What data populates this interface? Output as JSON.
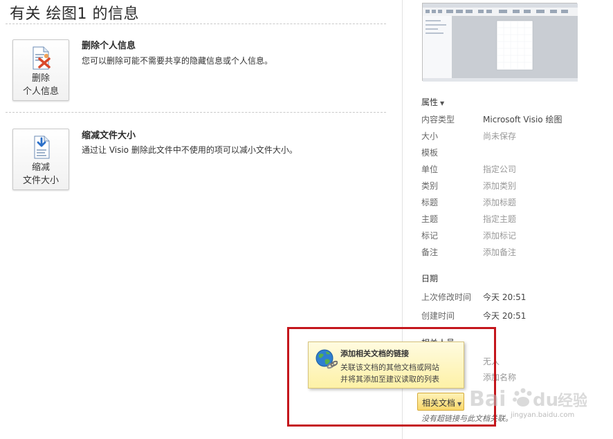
{
  "page": {
    "title": "有关 绘图1 的信息"
  },
  "sections": [
    {
      "button_line1": "删除",
      "button_line2": "个人信息",
      "heading": "删除个人信息",
      "description": "您可以删除可能不需要共享的隐藏信息或个人信息。",
      "icon": "remove-personal-info-icon"
    },
    {
      "button_line1": "缩减",
      "button_line2": "文件大小",
      "heading": "缩减文件大小",
      "description": "通过让 Visio 删除此文件中不使用的项可以减小文件大小。",
      "icon": "reduce-file-size-icon"
    }
  ],
  "properties": {
    "title": "属性",
    "rows": [
      {
        "key": "内容类型",
        "value": "Microsoft Visio 绘图",
        "editable": false
      },
      {
        "key": "大小",
        "value": "尚未保存",
        "editable": false
      },
      {
        "key": "模板",
        "value": "",
        "editable": false
      },
      {
        "key": "单位",
        "value": "指定公司",
        "editable": true
      },
      {
        "key": "类别",
        "value": "添加类别",
        "editable": true
      },
      {
        "key": "标题",
        "value": "添加标题",
        "editable": true
      },
      {
        "key": "主题",
        "value": "指定主题",
        "editable": true
      },
      {
        "key": "标记",
        "value": "添加标记",
        "editable": true
      },
      {
        "key": "备注",
        "value": "添加备注",
        "editable": true
      }
    ]
  },
  "dates": {
    "title": "日期",
    "rows": [
      {
        "key": "上次修改时间",
        "value": "今天 20:51"
      },
      {
        "key": "创建时间",
        "value": "今天 20:51"
      }
    ]
  },
  "related_people": {
    "title_partial": "相关人员",
    "rows": [
      {
        "value": "无人"
      },
      {
        "value": "添加名称"
      }
    ]
  },
  "tooltip": {
    "title": "添加相关文档的链接",
    "line1": "关联该文档的其他文档或网站",
    "line2": "并将其添加至建议读取的列表",
    "icon": "globe-link-icon"
  },
  "related_docs": {
    "button_label": "相关文档",
    "note": "没有超链接与此文档关联。"
  },
  "watermark": {
    "text": "Baidu经验",
    "url": "jingyan.baidu.com"
  },
  "colors": {
    "highlight_border": "#c4161c",
    "tooltip_bg": "#fdf1a6",
    "button_bg": "#f8d76a"
  }
}
